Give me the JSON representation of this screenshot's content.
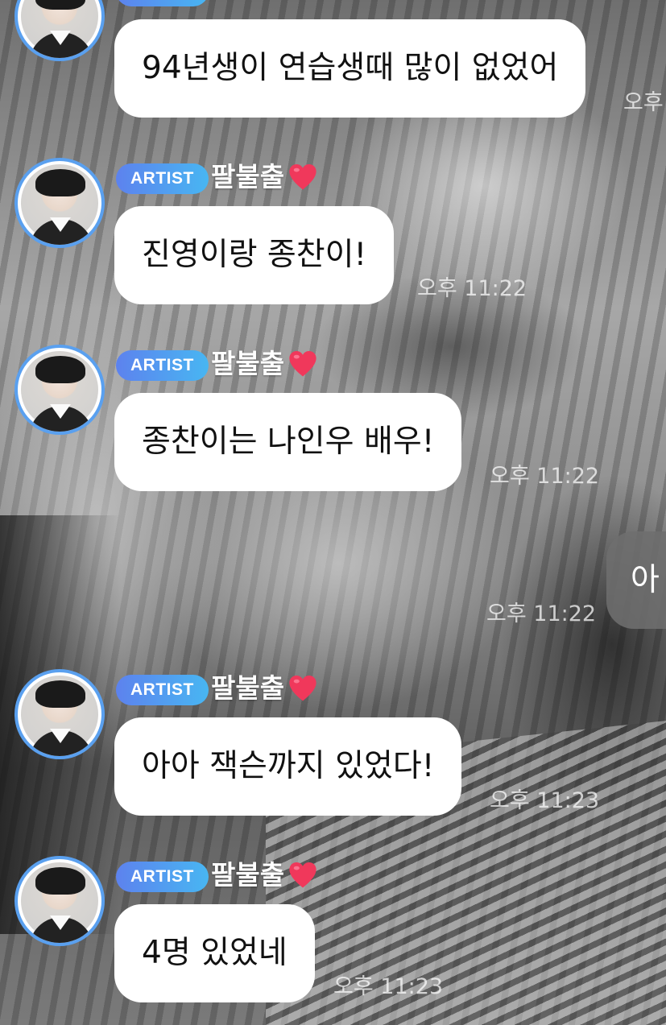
{
  "chat": {
    "sender_badge": "ARTIST",
    "sender_name": "팔불출",
    "messages": [
      {
        "text": "94년생이 연습생때 많이 없었어",
        "time": "오후"
      },
      {
        "text": "진영이랑 종찬이!",
        "time": "오후 11:22"
      },
      {
        "text": "종찬이는 나인우 배우!",
        "time": "오후 11:22"
      },
      {
        "text": "아아 잭슨까지 있었다!",
        "time": "오후 11:23"
      },
      {
        "text": "4명 있었네",
        "time": "오후 11:23"
      }
    ],
    "my_message": {
      "text": "아",
      "time": "오후 11:22"
    }
  },
  "colors": {
    "badge_gradient_start": "#5d82ee",
    "badge_gradient_end": "#48b6f2",
    "avatar_ring": "#5aa0ef",
    "heart": "#f0385b",
    "bubble": "#ffffff",
    "my_bubble": "#6e6e6e"
  },
  "icons": {
    "heart": "heart-icon",
    "avatar": "artist-avatar"
  }
}
